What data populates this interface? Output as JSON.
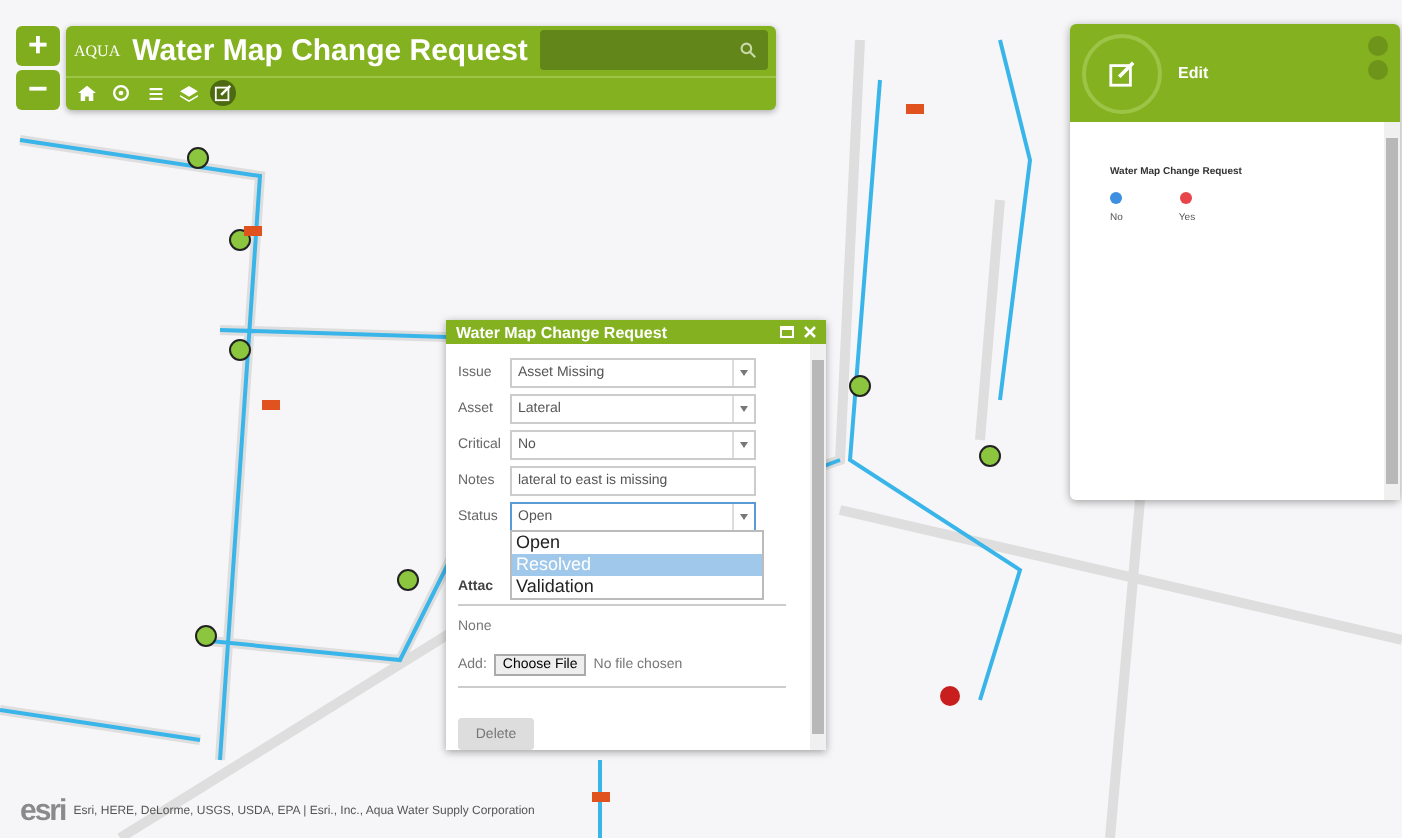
{
  "zoom": {
    "in": "+",
    "out": "−"
  },
  "header": {
    "logo": "AQUA",
    "title": "Water Map Change Request",
    "tools": [
      {
        "kind": "home",
        "selected": false
      },
      {
        "kind": "locate",
        "selected": false
      },
      {
        "kind": "list",
        "selected": false
      },
      {
        "kind": "layers",
        "selected": false
      },
      {
        "kind": "edit",
        "selected": true
      }
    ]
  },
  "popup": {
    "title": "Water Map Change Request",
    "fields": [
      {
        "label": "Issue",
        "kind": "select",
        "value": "Asset Missing",
        "focused": false
      },
      {
        "label": "Asset",
        "kind": "select",
        "value": "Lateral",
        "focused": false
      },
      {
        "label": "Critical",
        "kind": "select",
        "value": "No",
        "focused": false
      },
      {
        "label": "Notes",
        "kind": "text",
        "value": "lateral to east is missing",
        "focused": false
      },
      {
        "label": "Status",
        "kind": "select",
        "value": "Open",
        "focused": true,
        "options": [
          {
            "label": "Open",
            "highlighted": false
          },
          {
            "label": "Resolved",
            "highlighted": true
          },
          {
            "label": "Validation",
            "highlighted": false
          }
        ]
      }
    ],
    "attachments_title": "Attac",
    "attachments_value": "None",
    "add_label": "Add:",
    "file_button": "Choose File",
    "file_status": "No file chosen",
    "delete_button": "Delete"
  },
  "edit_panel": {
    "title": "Edit",
    "layer": "Water Map Change Request",
    "legend": [
      {
        "label": "No",
        "color": "#3d8fe0"
      },
      {
        "label": "Yes",
        "color": "#e8454a"
      }
    ]
  },
  "attribution": {
    "logo": "esri",
    "text": "Esri, HERE, DeLorme, USGS, USDA, EPA | Esri., Inc., Aqua Water Supply Corporation"
  }
}
